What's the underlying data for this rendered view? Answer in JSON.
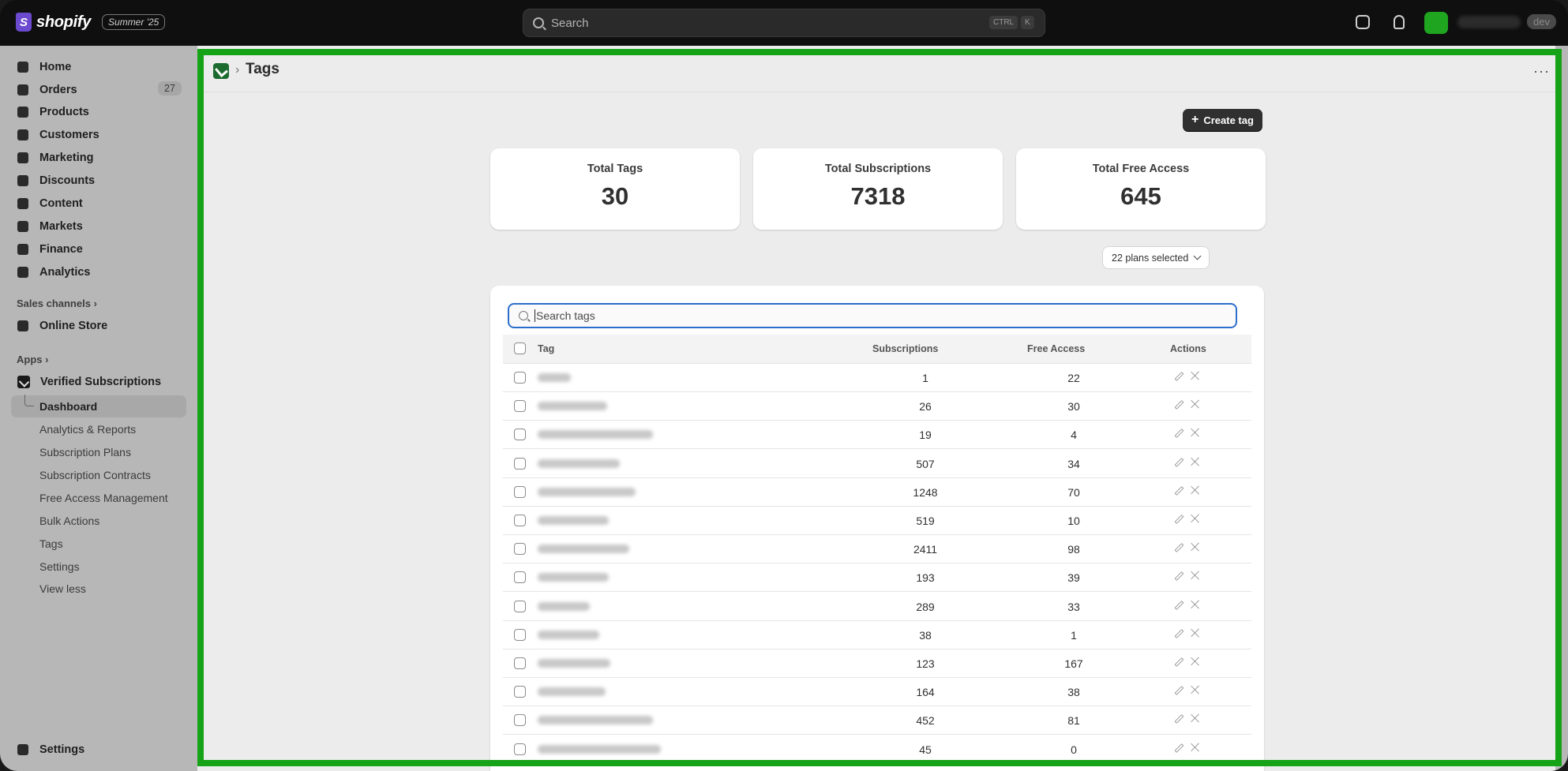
{
  "topbar": {
    "logo_text": "shopify",
    "logo_glyph": "S",
    "edition_badge": "Summer '25",
    "search_placeholder": "Search",
    "shortcut_key1": "CTRL",
    "shortcut_key2": "K",
    "dev_badge": "dev",
    "avatar_color": "#1fa51f"
  },
  "sidebar": {
    "main_items": [
      {
        "label": "Home",
        "icon": "home-icon"
      },
      {
        "label": "Orders",
        "icon": "inbox-icon",
        "count": "27"
      },
      {
        "label": "Products",
        "icon": "tag-icon"
      },
      {
        "label": "Customers",
        "icon": "person-icon"
      },
      {
        "label": "Marketing",
        "icon": "target-icon"
      },
      {
        "label": "Discounts",
        "icon": "discount-icon"
      },
      {
        "label": "Content",
        "icon": "image-icon"
      },
      {
        "label": "Markets",
        "icon": "globe-icon"
      },
      {
        "label": "Finance",
        "icon": "bank-icon"
      },
      {
        "label": "Analytics",
        "icon": "bar-chart-icon"
      }
    ],
    "sales_channels_title": "Sales channels",
    "online_store": "Online Store",
    "apps_title": "Apps",
    "app_name": "Verified Subscriptions",
    "app_sub_items": [
      "Dashboard",
      "Analytics & Reports",
      "Subscription Plans",
      "Subscription Contracts",
      "Free Access Management",
      "Bulk Actions",
      "Tags",
      "Settings",
      "View less"
    ],
    "settings": "Settings"
  },
  "page": {
    "title": "Tags",
    "create_button": "Create tag",
    "stats": [
      {
        "label": "Total Tags",
        "value": "30"
      },
      {
        "label": "Total Subscriptions",
        "value": "7318"
      },
      {
        "label": "Total Free Access",
        "value": "645"
      }
    ],
    "plans_filter": "22 plans selected",
    "search_placeholder": "Search tags",
    "columns": {
      "tag": "Tag",
      "subscriptions": "Subscriptions",
      "free_access": "Free Access",
      "actions": "Actions"
    },
    "rows": [
      {
        "subscriptions": "1",
        "free_access": "22"
      },
      {
        "subscriptions": "26",
        "free_access": "30"
      },
      {
        "subscriptions": "19",
        "free_access": "4"
      },
      {
        "subscriptions": "507",
        "free_access": "34"
      },
      {
        "subscriptions": "1248",
        "free_access": "70"
      },
      {
        "subscriptions": "519",
        "free_access": "10"
      },
      {
        "subscriptions": "2411",
        "free_access": "98"
      },
      {
        "subscriptions": "193",
        "free_access": "39"
      },
      {
        "subscriptions": "289",
        "free_access": "33"
      },
      {
        "subscriptions": "38",
        "free_access": "1"
      },
      {
        "subscriptions": "123",
        "free_access": "167"
      },
      {
        "subscriptions": "164",
        "free_access": "38"
      },
      {
        "subscriptions": "452",
        "free_access": "81"
      },
      {
        "subscriptions": "45",
        "free_access": "0"
      }
    ],
    "highlight_color": "#17a317"
  }
}
